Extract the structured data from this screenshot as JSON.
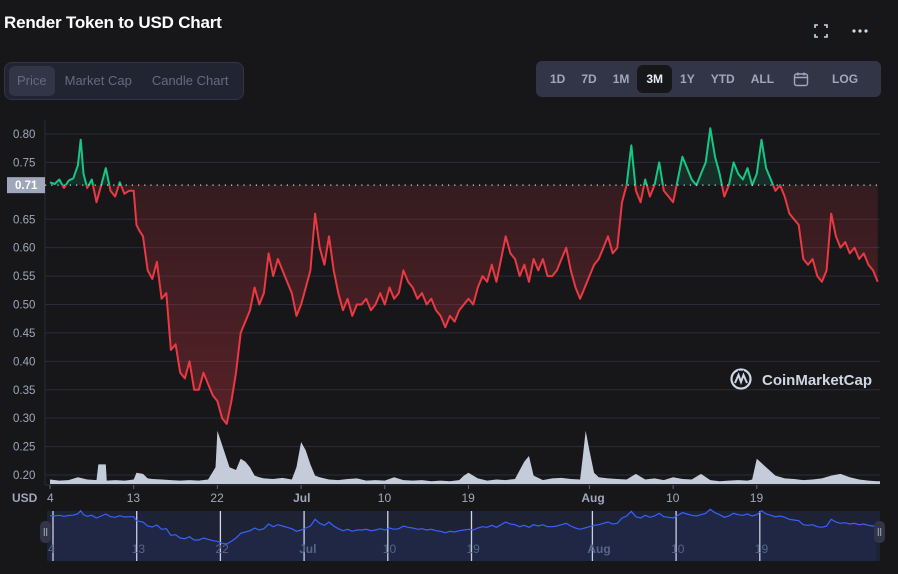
{
  "header": {
    "title": "Render Token to USD Chart",
    "fullscreen_icon": "fullscreen-icon",
    "more_icon": "more-horizontal-icon"
  },
  "view_tabs": [
    {
      "label": "Price",
      "active": true
    },
    {
      "label": "Market Cap",
      "active": false
    },
    {
      "label": "Candle Chart",
      "active": false
    }
  ],
  "range_tabs": [
    {
      "label": "1D",
      "active": false
    },
    {
      "label": "7D",
      "active": false
    },
    {
      "label": "1M",
      "active": false
    },
    {
      "label": "3M",
      "active": true
    },
    {
      "label": "1Y",
      "active": false
    },
    {
      "label": "YTD",
      "active": false
    },
    {
      "label": "ALL",
      "active": false
    }
  ],
  "calendar_icon": "calendar-icon",
  "log_label": "LOG",
  "watermark": "CoinMarketCap",
  "colors": {
    "up": "#16c784",
    "down": "#ea3943",
    "volume": "#cfd6e4",
    "navigator_line": "#3861fb",
    "grid": "#2a2c38",
    "axis_text": "#a1a7bb"
  },
  "chart_data": {
    "type": "line",
    "title": "Render Token to USD Chart",
    "xlabel": "",
    "ylabel": "USD",
    "ylim": [
      0.2,
      0.8
    ],
    "yticks": [
      "0.80",
      "0.75",
      "0.71",
      "0.65",
      "0.60",
      "0.55",
      "0.50",
      "0.45",
      "0.40",
      "0.35",
      "0.30",
      "0.25",
      "0.20"
    ],
    "reference_price": 0.71,
    "reference_label": "0.71",
    "xticks": [
      {
        "label": "4",
        "day": 0,
        "bold": false
      },
      {
        "label": "13",
        "day": 9,
        "bold": false
      },
      {
        "label": "22",
        "day": 18,
        "bold": false
      },
      {
        "label": "Jul",
        "day": 27,
        "bold": true
      },
      {
        "label": "10",
        "day": 36,
        "bold": false
      },
      {
        "label": "19",
        "day": 45,
        "bold": false
      },
      {
        "label": "Aug",
        "day": 58,
        "bold": true
      },
      {
        "label": "10",
        "day": 67,
        "bold": false
      },
      {
        "label": "19",
        "day": 76,
        "bold": false
      }
    ],
    "grid": true,
    "series": [
      {
        "name": "Price (USD)",
        "days": [
          0,
          0.5,
          1,
          1.5,
          2,
          2.5,
          3,
          3.3,
          3.6,
          4,
          4.5,
          5,
          5.5,
          6,
          6.5,
          7,
          7.5,
          8,
          8.5,
          9,
          9.3,
          9.6,
          10,
          10.5,
          11,
          11.5,
          12,
          12.5,
          13,
          13.5,
          14,
          14.5,
          15,
          15.5,
          16,
          16.5,
          17,
          17.5,
          18,
          18.5,
          19,
          19.5,
          20,
          20.5,
          21,
          21.5,
          22,
          22.5,
          23,
          23.5,
          24,
          24.5,
          25,
          25.5,
          26,
          26.5,
          27,
          27.5,
          28,
          28.5,
          29,
          29.5,
          30,
          30.5,
          31,
          31.5,
          32,
          32.5,
          33,
          33.5,
          34,
          34.5,
          35,
          35.5,
          36,
          36.5,
          37,
          37.5,
          38,
          38.5,
          39,
          39.5,
          40,
          40.5,
          41,
          41.5,
          42,
          42.5,
          43,
          43.5,
          44,
          44.5,
          45,
          45.5,
          46,
          46.5,
          47,
          47.5,
          48,
          48.5,
          49,
          49.5,
          50,
          50.5,
          51,
          51.5,
          52,
          52.5,
          53,
          53.5,
          54,
          54.5,
          55,
          55.5,
          56,
          56.5,
          57,
          57.5,
          58,
          58.5,
          59,
          59.5,
          60,
          60.5,
          61,
          61.5,
          62,
          62.5,
          63,
          63.5,
          64,
          64.5,
          65,
          65.5,
          66,
          66.5,
          67,
          67.5,
          68,
          68.5,
          69,
          69.5,
          70,
          70.5,
          71,
          71.5,
          72,
          72.5,
          73,
          73.5,
          74,
          74.5,
          75,
          75.5,
          76,
          76.5,
          77,
          77.5,
          78,
          78.5,
          79,
          79.5,
          80,
          80.5,
          81,
          81.5,
          82,
          82.5,
          83,
          83.5,
          84,
          84.5,
          85,
          85.5,
          86,
          86.5,
          87,
          87.5,
          88,
          88.5,
          89
        ],
        "values": [
          0.715,
          0.712,
          0.72,
          0.705,
          0.718,
          0.722,
          0.745,
          0.79,
          0.73,
          0.705,
          0.72,
          0.68,
          0.71,
          0.74,
          0.7,
          0.69,
          0.715,
          0.695,
          0.7,
          0.7,
          0.64,
          0.63,
          0.62,
          0.56,
          0.545,
          0.575,
          0.51,
          0.52,
          0.42,
          0.43,
          0.38,
          0.37,
          0.4,
          0.35,
          0.35,
          0.38,
          0.36,
          0.34,
          0.33,
          0.3,
          0.29,
          0.33,
          0.38,
          0.45,
          0.47,
          0.49,
          0.53,
          0.5,
          0.52,
          0.59,
          0.55,
          0.58,
          0.56,
          0.54,
          0.52,
          0.48,
          0.5,
          0.53,
          0.56,
          0.66,
          0.6,
          0.57,
          0.62,
          0.56,
          0.52,
          0.49,
          0.51,
          0.48,
          0.5,
          0.5,
          0.51,
          0.49,
          0.5,
          0.52,
          0.5,
          0.53,
          0.51,
          0.52,
          0.56,
          0.54,
          0.53,
          0.51,
          0.52,
          0.5,
          0.51,
          0.49,
          0.48,
          0.46,
          0.48,
          0.47,
          0.49,
          0.5,
          0.51,
          0.5,
          0.53,
          0.55,
          0.54,
          0.57,
          0.54,
          0.58,
          0.62,
          0.59,
          0.58,
          0.55,
          0.57,
          0.54,
          0.58,
          0.56,
          0.58,
          0.55,
          0.55,
          0.56,
          0.58,
          0.6,
          0.56,
          0.53,
          0.51,
          0.53,
          0.55,
          0.57,
          0.58,
          0.6,
          0.62,
          0.59,
          0.6,
          0.68,
          0.71,
          0.78,
          0.7,
          0.68,
          0.72,
          0.69,
          0.71,
          0.75,
          0.7,
          0.69,
          0.68,
          0.72,
          0.76,
          0.74,
          0.72,
          0.71,
          0.73,
          0.75,
          0.81,
          0.76,
          0.73,
          0.69,
          0.71,
          0.75,
          0.73,
          0.72,
          0.74,
          0.71,
          0.73,
          0.79,
          0.74,
          0.72,
          0.7,
          0.71,
          0.69,
          0.66,
          0.65,
          0.64,
          0.58,
          0.57,
          0.58,
          0.55,
          0.54,
          0.56,
          0.66,
          0.62,
          0.6,
          0.61,
          0.59,
          0.6,
          0.58,
          0.59,
          0.57,
          0.56,
          0.54,
          0.52,
          0.51,
          0.52,
          0.5,
          0.51,
          0.53,
          0.52,
          0.54,
          0.53,
          0.54,
          0.52,
          0.515,
          0.51
        ]
      },
      {
        "name": "Volume (relative)",
        "days": [
          0,
          1,
          2,
          3,
          4,
          5,
          5.2,
          6,
          6.1,
          7,
          8,
          9,
          9.3,
          10,
          10.5,
          11,
          12,
          13,
          14,
          15,
          16,
          17,
          17.8,
          18,
          18.5,
          19,
          19.3,
          20,
          20.5,
          21,
          21.5,
          22,
          22.5,
          23,
          24,
          25,
          26,
          26.5,
          27,
          27.5,
          28,
          28.5,
          29,
          30,
          31,
          32,
          33,
          34,
          35,
          36,
          37,
          38,
          39,
          40,
          41,
          42,
          43,
          44,
          44.5,
          45,
          46,
          47,
          48,
          49,
          50,
          51,
          51.5,
          52,
          53,
          54,
          55,
          56,
          57,
          57.3,
          57.6,
          58,
          58.5,
          59,
          60,
          61,
          62,
          63,
          64,
          65,
          66,
          67,
          68,
          69,
          70,
          71,
          72,
          73,
          74,
          75,
          75.5,
          76,
          77,
          78,
          79,
          80,
          81,
          82,
          83,
          84,
          85,
          86,
          87,
          88,
          89
        ],
        "values": [
          0.08,
          0.06,
          0.07,
          0.12,
          0.08,
          0.07,
          0.35,
          0.35,
          0.06,
          0.07,
          0.06,
          0.08,
          0.2,
          0.18,
          0.1,
          0.09,
          0.08,
          0.07,
          0.06,
          0.07,
          0.06,
          0.08,
          0.3,
          0.95,
          0.7,
          0.45,
          0.3,
          0.25,
          0.45,
          0.4,
          0.3,
          0.15,
          0.12,
          0.1,
          0.09,
          0.11,
          0.08,
          0.3,
          0.75,
          0.6,
          0.35,
          0.15,
          0.12,
          0.08,
          0.07,
          0.09,
          0.1,
          0.06,
          0.07,
          0.06,
          0.12,
          0.07,
          0.06,
          0.07,
          0.05,
          0.06,
          0.05,
          0.07,
          0.15,
          0.2,
          0.1,
          0.06,
          0.08,
          0.07,
          0.09,
          0.4,
          0.5,
          0.15,
          0.07,
          0.1,
          0.11,
          0.09,
          0.08,
          0.5,
          0.95,
          0.6,
          0.2,
          0.12,
          0.1,
          0.09,
          0.08,
          0.18,
          0.08,
          0.1,
          0.07,
          0.12,
          0.09,
          0.08,
          0.18,
          0.07,
          0.05,
          0.06,
          0.07,
          0.06,
          0.08,
          0.45,
          0.3,
          0.15,
          0.1,
          0.09,
          0.07,
          0.08,
          0.1,
          0.15,
          0.18,
          0.12,
          0.08,
          0.06,
          0.05
        ]
      }
    ],
    "navigator": {
      "xticks": [
        "4",
        "13",
        "22",
        "Jul",
        "10",
        "19",
        "Aug",
        "10",
        "19"
      ]
    },
    "legend": "none",
    "axis_unit_label": "USD"
  }
}
